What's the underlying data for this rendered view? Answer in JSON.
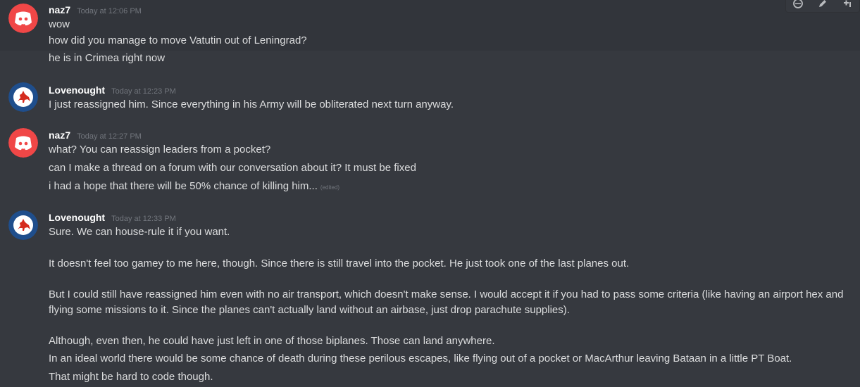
{
  "toolbar": {
    "icons": [
      "reaction-icon",
      "edit-icon",
      "more-icon"
    ]
  },
  "groups": [
    {
      "author": "naz7",
      "timestamp": "Today at 12:06 PM",
      "avatar": "discord-logo",
      "lines": [
        "wow",
        "how did you manage to move Vatutin out of Leningrad?",
        "he is in Crimea right now"
      ]
    },
    {
      "author": "Lovenought",
      "timestamp": "Today at 12:23 PM",
      "avatar": "raaf-roundel-kangaroo",
      "lines": [
        "I just reassigned him. Since everything in his Army will be obliterated next turn anyway."
      ]
    },
    {
      "author": "naz7",
      "timestamp": "Today at 12:27 PM",
      "avatar": "discord-logo",
      "lines": [
        "what? You can reassign leaders from a pocket?",
        "can I make a thread on a forum with our conversation about it? It must be fixed",
        "i had a hope that there will be 50% chance of killing him..."
      ],
      "edited": "(edited)"
    },
    {
      "author": "Lovenought",
      "timestamp": "Today at 12:33 PM",
      "avatar": "raaf-roundel-kangaroo",
      "lines": [
        "Sure. We can house-rule it if you want.",
        "It doesn't feel too gamey to me here, though. Since there is still travel into the pocket. He just took one of the last planes out.",
        "But I could still have reassigned him even with no air transport, which doesn't make sense. I would accept it if you had to pass some criteria (like having an airport hex and",
        "flying some missions to it. Since the planes can't actually land without an airbase, just drop parachute supplies).",
        "Although, even then, he could have just left in one of those biplanes. Those can land anywhere.",
        "In an ideal world there would be some chance of death during these perilous escapes, like flying out of a pocket or MacArthur leaving Bataan in a little PT Boat.",
        "That might be hard to code though."
      ]
    }
  ],
  "colors": {
    "background": "#36393f",
    "hover": "#32353b",
    "text": "#dcddde",
    "author": "#ffffff",
    "muted": "#72767d",
    "discord_red": "#f04747",
    "roundel_blue": "#1f4e8c"
  }
}
